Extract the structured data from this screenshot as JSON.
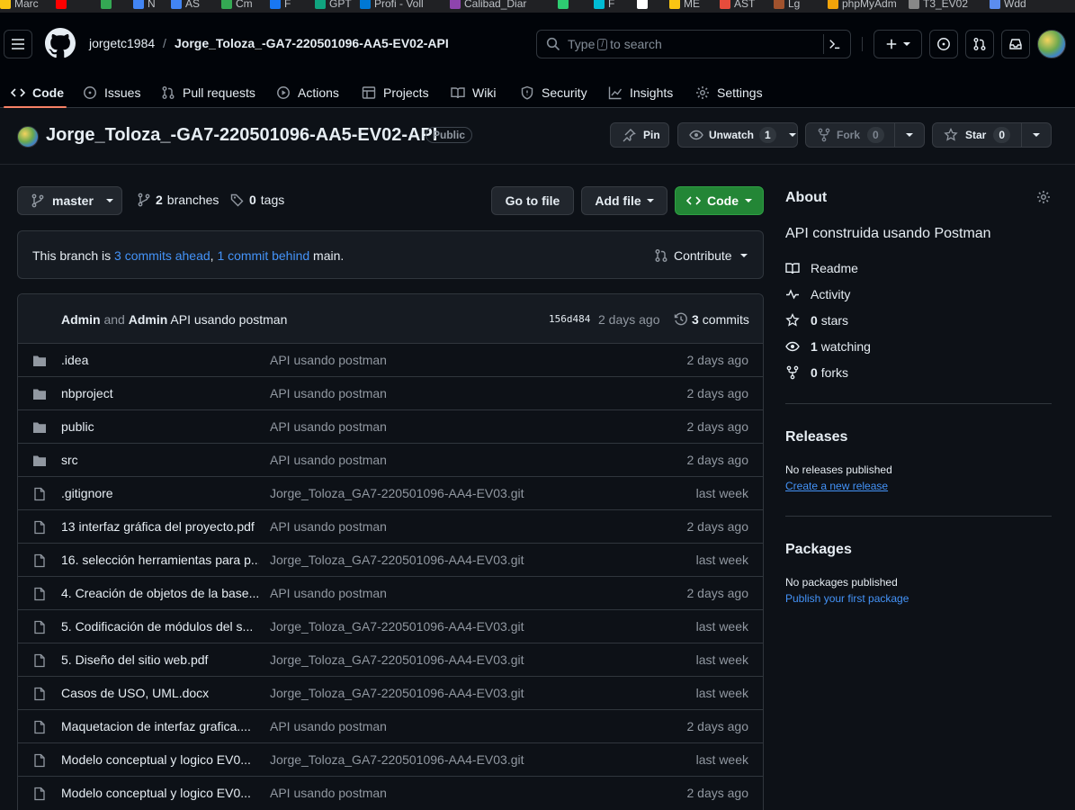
{
  "bookmarks": [
    {
      "label": "Marc",
      "color": "#f9c513"
    },
    {
      "label": "",
      "color": "#ff0000"
    },
    {
      "label": "",
      "color": "#34a853"
    },
    {
      "label": "N",
      "color": "#4285f4"
    },
    {
      "label": "AS",
      "color": "#4285f4"
    },
    {
      "label": "Cm",
      "color": "#34a853"
    },
    {
      "label": "F",
      "color": "#1877f2"
    },
    {
      "label": "GPT",
      "color": "#10a37f"
    },
    {
      "label": "Profi - Voll",
      "color": "#0078d4"
    },
    {
      "label": "Calibad_Diar",
      "color": "#8e44ad"
    },
    {
      "label": "",
      "color": "#2ecc71"
    },
    {
      "label": "F",
      "color": "#00bcd4"
    },
    {
      "label": "",
      "color": "#ffffff"
    },
    {
      "label": "ME",
      "color": "#f9c513"
    },
    {
      "label": "AST",
      "color": "#e74c3c"
    },
    {
      "label": "Lg",
      "color": "#a0522d"
    },
    {
      "label": "phpMyAdm",
      "color": "#f0a30a"
    },
    {
      "label": "T3_EV02",
      "color": "#888888"
    },
    {
      "label": "Wdd",
      "color": "#5b8def"
    }
  ],
  "header": {
    "owner": "jorgetc1984",
    "separator": "/",
    "repo": "Jorge_Toloza_-GA7-220501096-AA5-EV02-API",
    "search_prefix": "Type",
    "search_key": "/",
    "search_suffix": "to search",
    "command_icon": "command-palette-icon"
  },
  "tabs": [
    {
      "label": "Code",
      "icon": "code-icon",
      "selected": true
    },
    {
      "label": "Issues",
      "icon": "issue-icon"
    },
    {
      "label": "Pull requests",
      "icon": "pull-request-icon"
    },
    {
      "label": "Actions",
      "icon": "play-icon"
    },
    {
      "label": "Projects",
      "icon": "table-icon"
    },
    {
      "label": "Wiki",
      "icon": "book-icon"
    },
    {
      "label": "Security",
      "icon": "shield-icon"
    },
    {
      "label": "Insights",
      "icon": "graph-icon"
    },
    {
      "label": "Settings",
      "icon": "gear-icon"
    }
  ],
  "repo_header": {
    "title": "Jorge_Toloza_-GA7-220501096-AA5-EV02-API",
    "visibility": "Public",
    "pin": "Pin",
    "unwatch": "Unwatch",
    "watch_count": "1",
    "fork": "Fork",
    "fork_count": "0",
    "star": "Star",
    "star_count": "0"
  },
  "toolbar": {
    "branch": "master",
    "branches_count": "2",
    "branches_label": "branches",
    "tags_count": "0",
    "tags_label": "tags",
    "go_to_file": "Go to file",
    "add_file": "Add file",
    "code": "Code"
  },
  "branch_status": {
    "prefix": "This branch is",
    "ahead": "3 commits ahead",
    "comma": ",",
    "behind": "1 commit behind",
    "suffix": "main.",
    "contribute": "Contribute"
  },
  "commit": {
    "author1": "Admin",
    "and": "and",
    "author2": "Admin",
    "message": "API usando postman",
    "sha": "156d484",
    "age": "2 days ago",
    "count": "3",
    "count_label": "commits"
  },
  "files": [
    {
      "type": "dir",
      "name": ".idea",
      "message": "API usando postman",
      "age": "2 days ago"
    },
    {
      "type": "dir",
      "name": "nbproject",
      "message": "API usando postman",
      "age": "2 days ago"
    },
    {
      "type": "dir",
      "name": "public",
      "message": "API usando postman",
      "age": "2 days ago"
    },
    {
      "type": "dir",
      "name": "src",
      "message": "API usando postman",
      "age": "2 days ago"
    },
    {
      "type": "file",
      "name": ".gitignore",
      "message": "Jorge_Toloza_GA7-220501096-AA4-EV03.git",
      "age": "last week"
    },
    {
      "type": "file",
      "name": "13 interfaz gráfica del proyecto.pdf",
      "message": "API usando postman",
      "age": "2 days ago"
    },
    {
      "type": "file",
      "name": "16. selección herramientas para p...",
      "message": "Jorge_Toloza_GA7-220501096-AA4-EV03.git",
      "age": "last week"
    },
    {
      "type": "file",
      "name": "4. Creación de objetos de la base...",
      "message": "API usando postman",
      "age": "2 days ago"
    },
    {
      "type": "file",
      "name": "5. Codificación de módulos del s...",
      "message": "Jorge_Toloza_GA7-220501096-AA4-EV03.git",
      "age": "last week"
    },
    {
      "type": "file",
      "name": "5. Diseño del sitio web.pdf",
      "message": "Jorge_Toloza_GA7-220501096-AA4-EV03.git",
      "age": "last week"
    },
    {
      "type": "file",
      "name": "Casos de USO, UML.docx",
      "message": "Jorge_Toloza_GA7-220501096-AA4-EV03.git",
      "age": "last week"
    },
    {
      "type": "file",
      "name": "Maquetacion de interfaz grafica....",
      "message": "API usando postman",
      "age": "2 days ago"
    },
    {
      "type": "file",
      "name": "Modelo conceptual y logico EV0...",
      "message": "Jorge_Toloza_GA7-220501096-AA4-EV03.git",
      "age": "last week"
    },
    {
      "type": "file",
      "name": "Modelo conceptual y logico EV0...",
      "message": "API usando postman",
      "age": "2 days ago"
    }
  ],
  "about": {
    "title": "About",
    "description": "API construida usando Postman",
    "readme": "Readme",
    "activity": "Activity",
    "stars_count": "0",
    "stars_label": "stars",
    "watching_count": "1",
    "watching_label": "watching",
    "forks_count": "0",
    "forks_label": "forks"
  },
  "releases": {
    "title": "Releases",
    "empty": "No releases published",
    "link": "Create a new release"
  },
  "packages": {
    "title": "Packages",
    "empty": "No packages published",
    "link": "Publish your first package"
  },
  "colors": {
    "accent_link": "#4493f8",
    "code_button": "#238636",
    "tab_underline": "#f78166"
  }
}
